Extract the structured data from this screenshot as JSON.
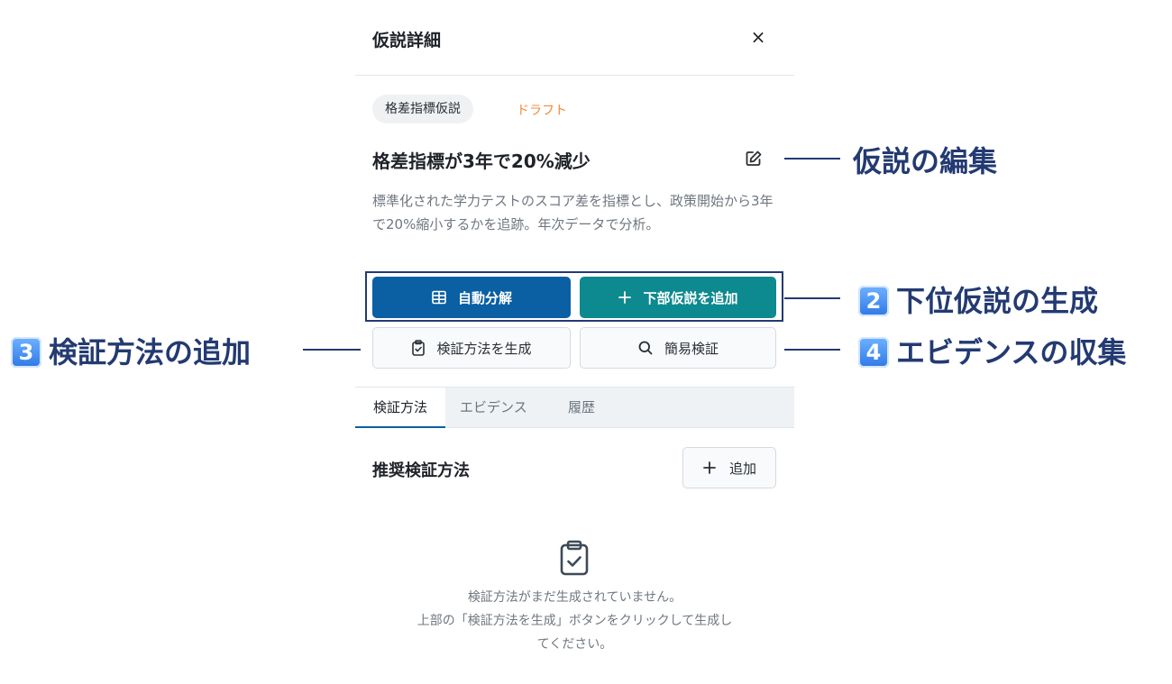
{
  "panel": {
    "title": "仮説詳細",
    "close_label": "×",
    "tag": "格差指標仮説",
    "status": "ドラフト",
    "hypothesis_title": "格差指標が3年で20%減少",
    "description": "標準化された学力テストのスコア差を指標とし、政策開始から3年で20%縮小するかを追跡。年次データで分析。"
  },
  "actions": {
    "auto_decompose": "自動分解",
    "add_sub_hypothesis": "下部仮説を追加",
    "generate_method": "検証方法を生成",
    "quick_verify": "簡易検証"
  },
  "tabs": [
    "検証方法",
    "エビデンス",
    "履歴"
  ],
  "section": {
    "title": "推奨検証方法",
    "add_label": "追加"
  },
  "empty_state": {
    "line1": "検証方法がまだ生成されていません。",
    "line2": "上部の「検証方法を生成」ボタンをクリックして生成し",
    "line3": "てください。"
  },
  "annotations": {
    "edit": "仮説の編集",
    "sub": {
      "num": "2",
      "text": "下位仮説の生成"
    },
    "method": {
      "num": "3",
      "text": "検証方法の追加"
    },
    "evidence": {
      "num": "4",
      "text": "エビデンスの収集"
    }
  },
  "colors": {
    "primary": "#0b5fa3",
    "teal": "#0d8a8f",
    "draft": "#f08a3a",
    "annotation": "#233a72",
    "badge": "#2f78e6"
  },
  "icons": [
    "close-icon",
    "edit-icon",
    "table-icon",
    "plus-icon",
    "clipboard-check-icon",
    "search-icon"
  ]
}
